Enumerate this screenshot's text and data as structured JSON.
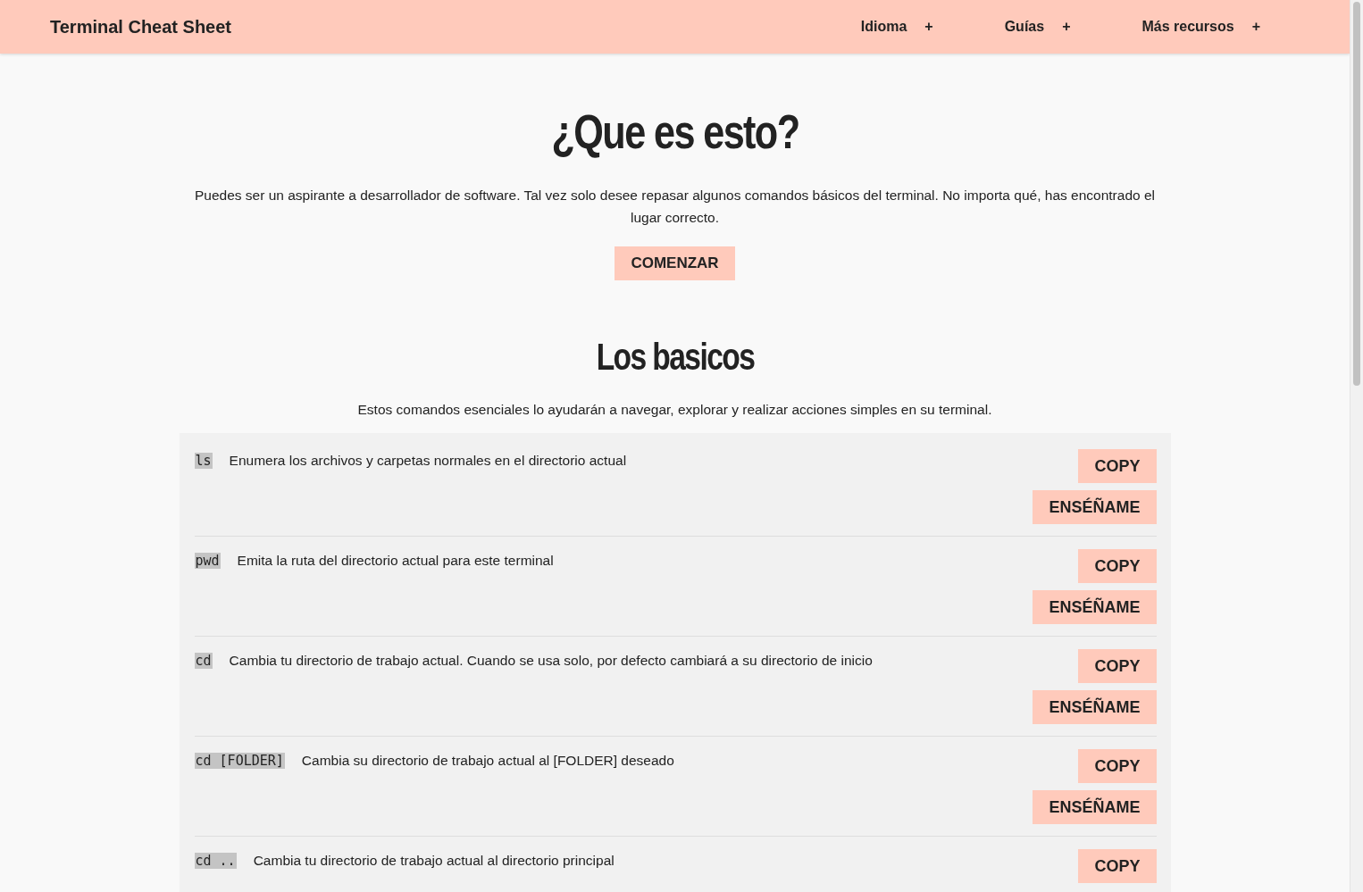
{
  "header": {
    "title": "Terminal Cheat Sheet",
    "menu": [
      {
        "label": "Idioma",
        "toggle": "+"
      },
      {
        "label": "Guías",
        "toggle": "+"
      },
      {
        "label": "Más recursos",
        "toggle": "+"
      }
    ]
  },
  "intro": {
    "heading": "¿Que es esto?",
    "text": "Puedes ser un aspirante a desarrollador de software. Tal vez solo desee repasar algunos comandos básicos del terminal. No importa qué, has encontrado el lugar correcto.",
    "button": "COMENZAR"
  },
  "basics": {
    "heading": "Los basicos",
    "text": "Estos comandos esenciales lo ayudarán a navegar, explorar y realizar acciones simples en su terminal.",
    "commands": [
      {
        "command": "ls",
        "description": "Enumera los archivos y carpetas normales en el directorio actual",
        "buttons": [
          "COPY",
          "ENSÉÑAME"
        ]
      },
      {
        "command": "pwd",
        "description": "Emita la ruta del directorio actual para este terminal",
        "buttons": [
          "COPY",
          "ENSÉÑAME"
        ]
      },
      {
        "command": "cd",
        "description": "Cambia tu directorio de trabajo actual. Cuando se usa solo, por defecto cambiará a su directorio de inicio",
        "buttons": [
          "COPY",
          "ENSÉÑAME"
        ]
      },
      {
        "command": "cd [FOLDER]",
        "description": "Cambia su directorio de trabajo actual al [FOLDER] deseado",
        "buttons": [
          "COPY",
          "ENSÉÑAME"
        ]
      },
      {
        "command": "cd ..",
        "description": "Cambia tu directorio de trabajo actual al directorio principal",
        "buttons": [
          "COPY"
        ]
      }
    ]
  }
}
